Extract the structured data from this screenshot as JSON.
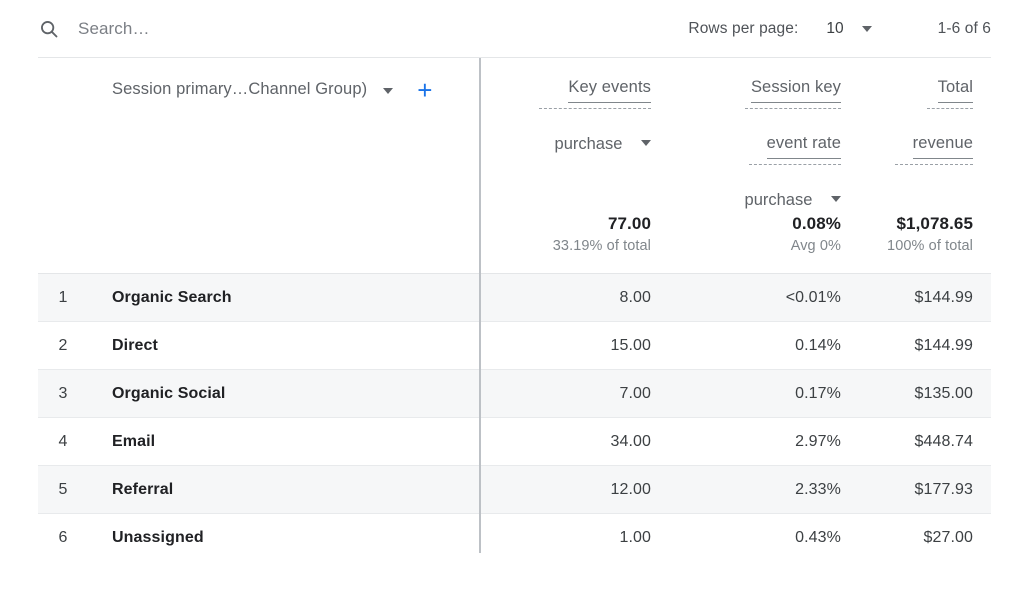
{
  "toolbar": {
    "search_icon": "search-icon",
    "search_placeholder": "Search…",
    "search_value": "",
    "rows_per_page_label": "Rows per page:",
    "rows_per_page_value": "10",
    "range_label": "1-6 of 6"
  },
  "table": {
    "dimension_header": {
      "label": "Session primary…Channel Group)",
      "add_label": "+"
    },
    "metric_headers": [
      {
        "name_lines": [
          "Key events"
        ],
        "sub": "purchase"
      },
      {
        "name_lines": [
          "Session key",
          "event rate"
        ],
        "sub": "purchase"
      },
      {
        "name_lines": [
          "Total",
          "revenue"
        ],
        "sub": ""
      }
    ],
    "totals": [
      {
        "value": "77.00",
        "sub": "33.19% of total"
      },
      {
        "value": "0.08%",
        "sub": "Avg 0%"
      },
      {
        "value": "$1,078.65",
        "sub": "100% of total"
      }
    ],
    "rows": [
      {
        "index": "1",
        "dimension": "Organic Search",
        "key_events": "8.00",
        "session_key_event_rate": "<0.01%",
        "total_revenue": "$144.99"
      },
      {
        "index": "2",
        "dimension": "Direct",
        "key_events": "15.00",
        "session_key_event_rate": "0.14%",
        "total_revenue": "$144.99"
      },
      {
        "index": "3",
        "dimension": "Organic Social",
        "key_events": "7.00",
        "session_key_event_rate": "0.17%",
        "total_revenue": "$135.00"
      },
      {
        "index": "4",
        "dimension": "Email",
        "key_events": "34.00",
        "session_key_event_rate": "2.97%",
        "total_revenue": "$448.74"
      },
      {
        "index": "5",
        "dimension": "Referral",
        "key_events": "12.00",
        "session_key_event_rate": "2.33%",
        "total_revenue": "$177.93"
      },
      {
        "index": "6",
        "dimension": "Unassigned",
        "key_events": "1.00",
        "session_key_event_rate": "0.43%",
        "total_revenue": "$27.00"
      }
    ]
  },
  "colors": {
    "accent": "#1a73e8",
    "text_primary": "#202124",
    "text_secondary": "#5f6368",
    "row_alt_bg": "#f6f7f8",
    "border": "#e4e6e8"
  }
}
